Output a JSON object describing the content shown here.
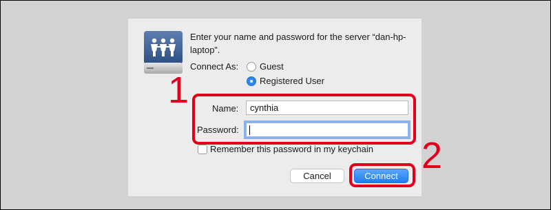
{
  "dialog": {
    "prompt": "Enter your name and password for the server “dan-hp-laptop”.",
    "icon": "shared-server-icon",
    "connect_as": {
      "label": "Connect As:",
      "options": [
        {
          "label": "Guest",
          "selected": false
        },
        {
          "label": "Registered User",
          "selected": true
        }
      ]
    },
    "name": {
      "label": "Name:",
      "value": "cynthia"
    },
    "password": {
      "label": "Password:",
      "value": ""
    },
    "remember": {
      "label": "Remember this password in my keychain",
      "checked": false
    },
    "buttons": {
      "cancel": "Cancel",
      "connect": "Connect"
    }
  },
  "annotations": {
    "step1": "1",
    "step2": "2",
    "color": "#e0001b"
  }
}
